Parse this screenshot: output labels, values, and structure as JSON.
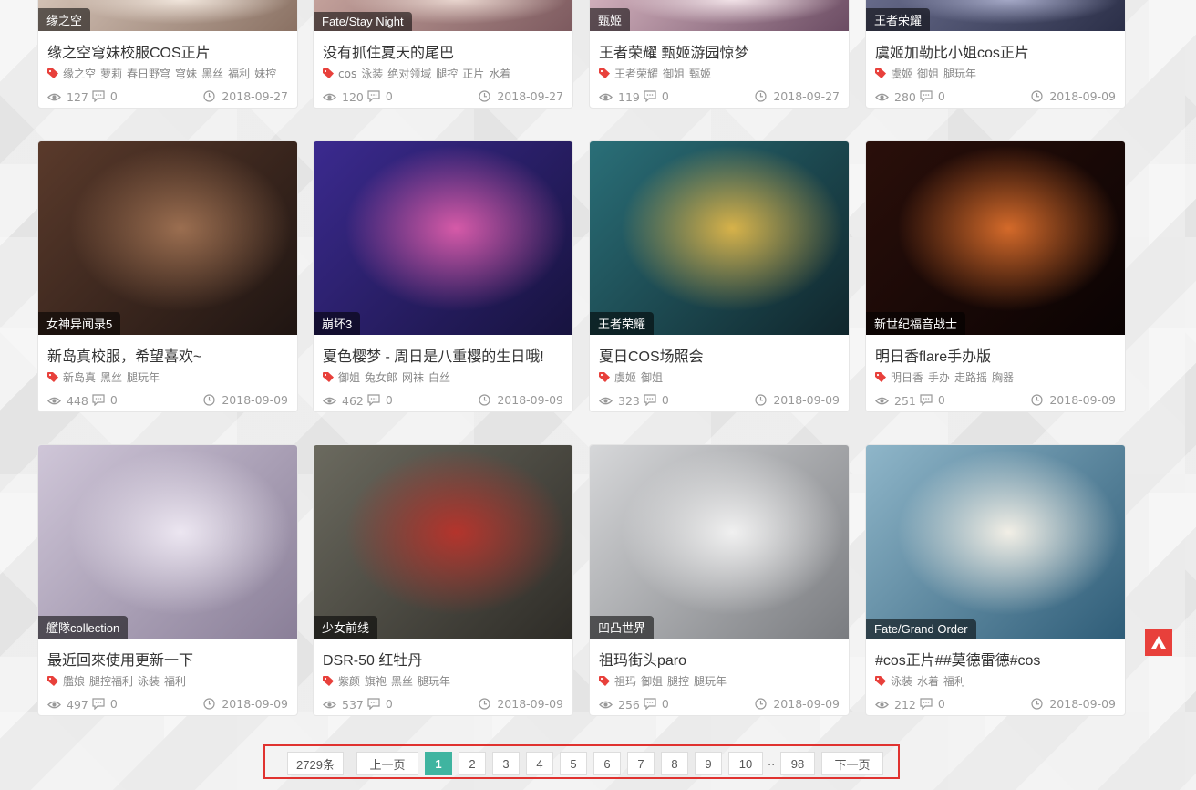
{
  "colors": {
    "accent": "#3fb4a0",
    "tag_red": "#e8403b",
    "highlight_border": "#e0322f"
  },
  "rows": [
    {
      "cards": [
        {
          "category": "缘之空",
          "title": "缘之空穹妹校服COS正片",
          "tags": [
            "缘之空",
            "萝莉",
            "春日野穹",
            "穹妹",
            "黑丝",
            "福利",
            "妹控"
          ],
          "views": "127",
          "comments": "0",
          "date": "2018-09-27"
        },
        {
          "category": "Fate/Stay Night",
          "title": "没有抓住夏天的尾巴",
          "tags": [
            "cos",
            "泳装",
            "绝对领域",
            "腿控",
            "正片",
            "水着"
          ],
          "views": "120",
          "comments": "0",
          "date": "2018-09-27"
        },
        {
          "category": "甄姬",
          "title": "王者荣耀 甄姬游园惊梦",
          "tags": [
            "王者荣耀",
            "御姐",
            "甄姬"
          ],
          "views": "119",
          "comments": "0",
          "date": "2018-09-27"
        },
        {
          "category": "王者荣耀",
          "title": "虞姬加勒比小姐cos正片",
          "tags": [
            "虞姬",
            "御姐",
            "腿玩年"
          ],
          "views": "280",
          "comments": "0",
          "date": "2018-09-09"
        }
      ]
    },
    {
      "cards": [
        {
          "category": "女神异闻录5",
          "title": "新岛真校服，希望喜欢~",
          "tags": [
            "新岛真",
            "黑丝",
            "腿玩年"
          ],
          "views": "448",
          "comments": "0",
          "date": "2018-09-09"
        },
        {
          "category": "崩坏3",
          "title": "夏色樱梦 - 周日是八重樱的生日哦!",
          "tags": [
            "御姐",
            "兔女郎",
            "网袜",
            "白丝"
          ],
          "views": "462",
          "comments": "0",
          "date": "2018-09-09"
        },
        {
          "category": "王者荣耀",
          "title": "夏日COS场照会",
          "tags": [
            "虞姬",
            "御姐"
          ],
          "views": "323",
          "comments": "0",
          "date": "2018-09-09"
        },
        {
          "category": "新世纪福音战士",
          "title": "明日香flare手办版",
          "tags": [
            "明日香",
            "手办",
            "走路摇",
            "胸器"
          ],
          "views": "251",
          "comments": "0",
          "date": "2018-09-09"
        }
      ]
    },
    {
      "cards": [
        {
          "category": "艦隊collection",
          "title": "最近回來使用更新一下",
          "tags": [
            "艦娘",
            "腿控福利",
            "泳装",
            "福利"
          ],
          "views": "497",
          "comments": "0",
          "date": "2018-09-09"
        },
        {
          "category": "少女前线",
          "title": "DSR-50 红牡丹",
          "tags": [
            "紫颜",
            "旗袍",
            "黑丝",
            "腿玩年"
          ],
          "views": "537",
          "comments": "0",
          "date": "2018-09-09"
        },
        {
          "category": "凹凸世界",
          "title": "祖玛街头paro",
          "tags": [
            "祖玛",
            "御姐",
            "腿控",
            "腿玩年"
          ],
          "views": "256",
          "comments": "0",
          "date": "2018-09-09"
        },
        {
          "category": "Fate/Grand Order",
          "title": "#cos正片##莫德雷德#cos",
          "tags": [
            "泳装",
            "水着",
            "福利"
          ],
          "views": "212",
          "comments": "0",
          "date": "2018-09-09"
        }
      ]
    }
  ],
  "pagination": {
    "total": "2729条",
    "prev": "上一页",
    "pages": [
      "1",
      "2",
      "3",
      "4",
      "5",
      "6",
      "7",
      "8",
      "9",
      "10"
    ],
    "ellipsis": "..",
    "last": "98",
    "next": "下一页",
    "current": "1"
  },
  "icons": {
    "tag": "tag-icon",
    "views": "eye-icon",
    "comments": "comment-icon",
    "date": "clock-icon",
    "back_to_top": "arrow-up-icon"
  }
}
